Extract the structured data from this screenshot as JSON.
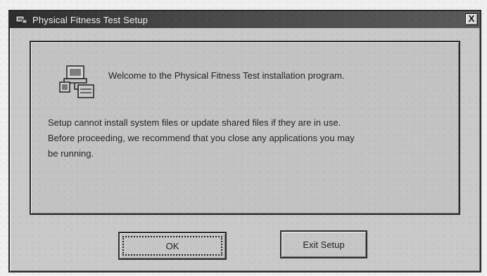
{
  "window": {
    "title": "Physical Fitness Test Setup",
    "close_label": "X"
  },
  "content": {
    "welcome": "Welcome to the Physical Fitness Test installation program.",
    "message_line1": "Setup cannot install system files or update shared files if they are in use.",
    "message_line2": "Before proceeding, we recommend that you close any applications you may",
    "message_line3": "be running."
  },
  "buttons": {
    "ok": "OK",
    "exit": "Exit Setup"
  },
  "icons": {
    "title_icon": "setup-icon",
    "main_icon": "computer-setup-icon",
    "close_icon": "close-icon"
  }
}
